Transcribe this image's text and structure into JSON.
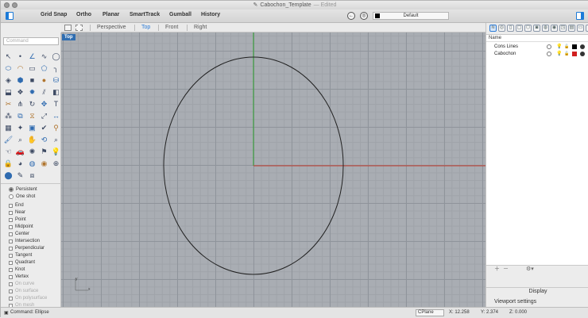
{
  "window": {
    "title": "Cabochon_Template",
    "edited_suffix": "— Edited"
  },
  "toolbar": {
    "buttons": [
      "Grid Snap",
      "Ortho",
      "Planar",
      "SmartTrack",
      "Gumball",
      "History"
    ],
    "layer_selector": "Default"
  },
  "viewport_tabs": [
    "Perspective",
    "Top",
    "Front",
    "Right"
  ],
  "active_viewport": "Top",
  "viewport_label": "Top",
  "command_placeholder": "Command",
  "osnap_options": {
    "persistent": "Persistent",
    "one_shot": "One shot",
    "items": [
      {
        "label": "End",
        "enabled": true
      },
      {
        "label": "Near",
        "enabled": true
      },
      {
        "label": "Point",
        "enabled": true
      },
      {
        "label": "Midpoint",
        "enabled": true
      },
      {
        "label": "Center",
        "enabled": true
      },
      {
        "label": "Intersection",
        "enabled": true
      },
      {
        "label": "Perpendicular",
        "enabled": true
      },
      {
        "label": "Tangent",
        "enabled": true
      },
      {
        "label": "Quadrant",
        "enabled": true
      },
      {
        "label": "Knot",
        "enabled": true
      },
      {
        "label": "Vertex",
        "enabled": true
      },
      {
        "label": "On curve",
        "enabled": false
      },
      {
        "label": "On surface",
        "enabled": false
      },
      {
        "label": "On polysurface",
        "enabled": false
      },
      {
        "label": "On mesh",
        "enabled": false
      }
    ]
  },
  "layers": {
    "header": "Name",
    "rows": [
      {
        "name": "Cons Lines",
        "color": "#000000"
      },
      {
        "name": "Cabochon",
        "color": "#d11f1f"
      }
    ]
  },
  "right_panel": {
    "display": "Display",
    "viewport_settings": "Viewport settings"
  },
  "status": {
    "command": "Command: Ellipse",
    "cplane": "CPlane",
    "x": "X: 12.258",
    "y": "Y: 2.374",
    "z": "Z: 0.000"
  },
  "axes_label": {
    "x": "x",
    "y": "y"
  },
  "colors": {
    "accent": "#2a7ad6",
    "x_axis": "#c0392b",
    "y_axis": "#2ca02c",
    "grid": "#a9adb3"
  }
}
